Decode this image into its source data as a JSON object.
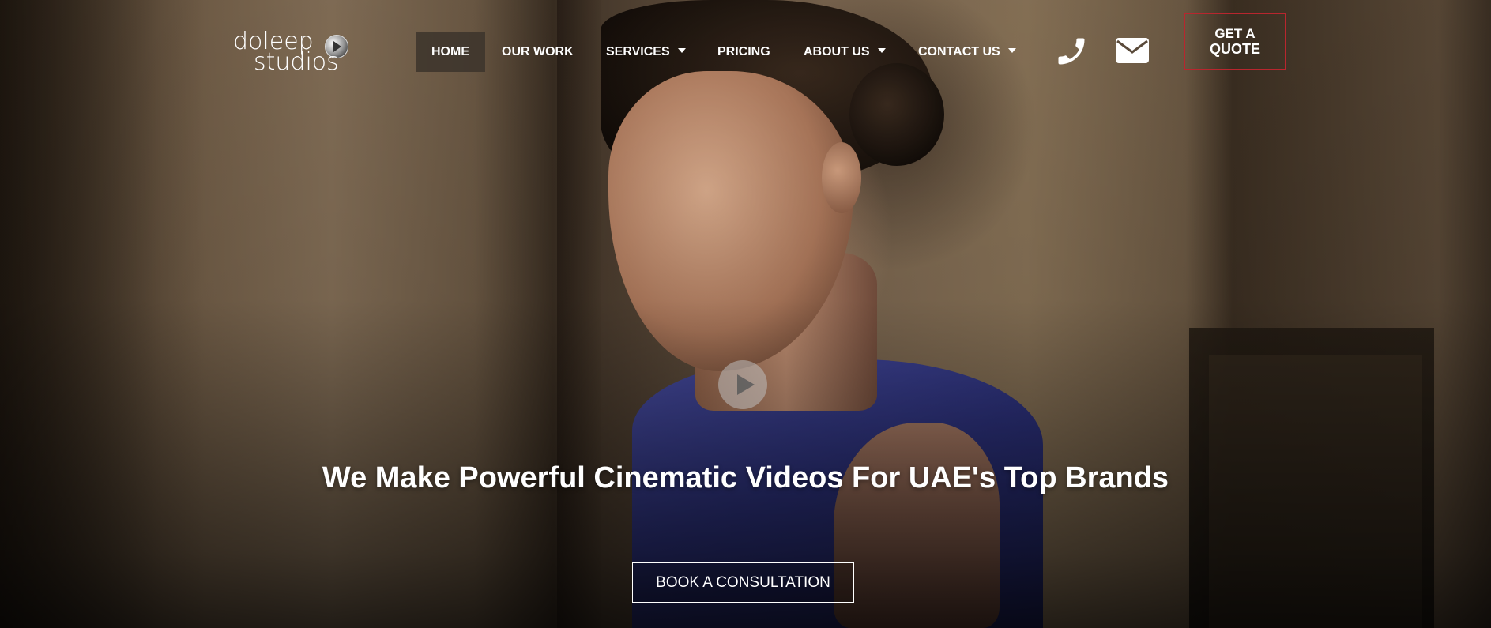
{
  "logo": {
    "line1": "doleep",
    "line2": "studios",
    "mark_icon": "play-orb-icon"
  },
  "nav": {
    "items": [
      {
        "label": "HOME",
        "active": true,
        "has_dropdown": false
      },
      {
        "label": "OUR WORK",
        "active": false,
        "has_dropdown": false
      },
      {
        "label": "SERVICES",
        "active": false,
        "has_dropdown": true
      },
      {
        "label": "PRICING",
        "active": false,
        "has_dropdown": false
      },
      {
        "label": "ABOUT US",
        "active": false,
        "has_dropdown": true
      },
      {
        "label": "CONTACT US",
        "active": false,
        "has_dropdown": true
      }
    ]
  },
  "header_icons": {
    "phone": "phone-icon",
    "email": "envelope-icon"
  },
  "quote_button": {
    "line1": "GET A",
    "line2": "QUOTE",
    "border_color": "#b8262e"
  },
  "hero": {
    "play_icon": "play-icon",
    "headline": "We Make Powerful Cinematic Videos For UAE's Top Brands",
    "cta_label": "BOOK A CONSULTATION"
  }
}
